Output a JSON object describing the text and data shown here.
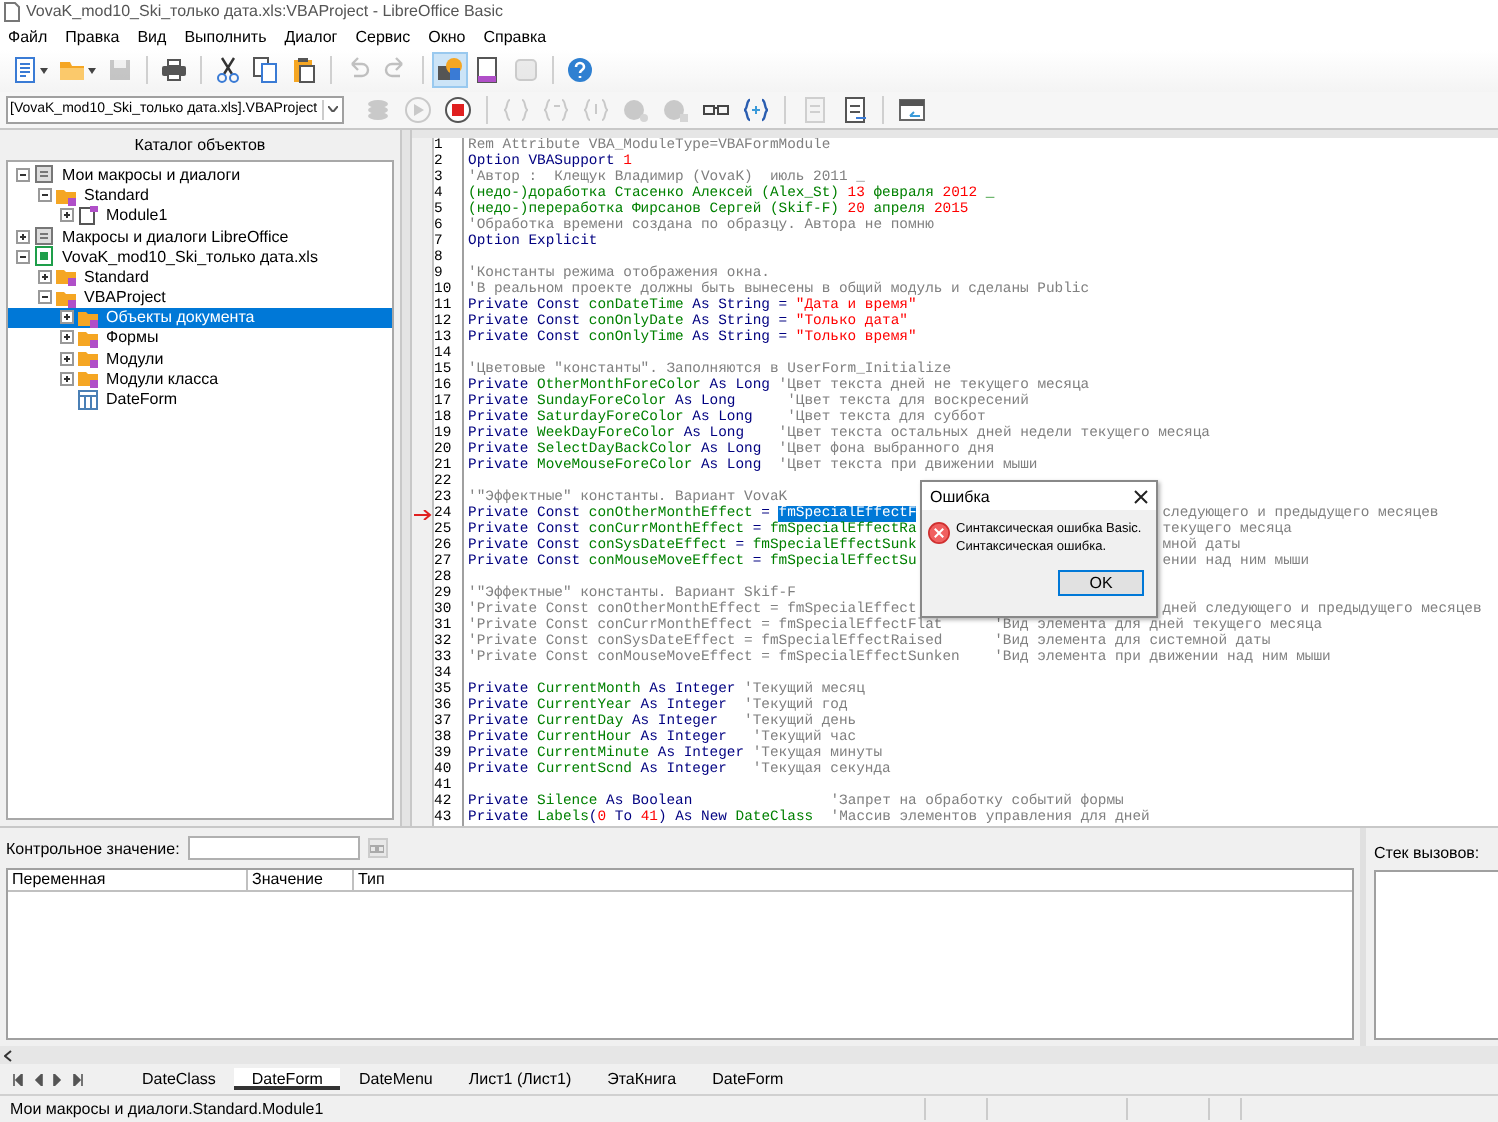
{
  "window": {
    "title": "VovaK_mod10_Ski_только дата.xls:VBAProject - LibreOffice Basic"
  },
  "menu": [
    "Файл",
    "Правка",
    "Вид",
    "Выполнить",
    "Диалог",
    "Сервис",
    "Окно",
    "Справка"
  ],
  "toolbar": [
    {
      "kind": "new",
      "menu": true,
      "disabled": false,
      "active": false
    },
    {
      "kind": "open",
      "menu": true,
      "disabled": false,
      "active": false
    },
    {
      "kind": "save",
      "menu": false,
      "disabled": true,
      "active": false
    },
    {
      "kind": "sep"
    },
    {
      "kind": "print",
      "menu": false,
      "disabled": false,
      "active": false
    },
    {
      "kind": "sep"
    },
    {
      "kind": "cut",
      "menu": false,
      "disabled": false,
      "active": false
    },
    {
      "kind": "copy",
      "menu": false,
      "disabled": false,
      "active": false
    },
    {
      "kind": "paste",
      "menu": false,
      "disabled": false,
      "active": false
    },
    {
      "kind": "sep"
    },
    {
      "kind": "undo",
      "menu": false,
      "disabled": true,
      "active": false
    },
    {
      "kind": "redo",
      "menu": false,
      "disabled": true,
      "active": false
    },
    {
      "kind": "sep"
    },
    {
      "kind": "catalog",
      "menu": false,
      "disabled": false,
      "active": true
    },
    {
      "kind": "dialog",
      "menu": false,
      "disabled": false,
      "active": false
    },
    {
      "kind": "macros",
      "menu": false,
      "disabled": true,
      "active": false
    },
    {
      "kind": "sep"
    },
    {
      "kind": "help",
      "menu": false,
      "disabled": false,
      "active": false
    }
  ],
  "library_select": {
    "value": "[VovaK_mod10_Ski_только дата.xls].VBAProject"
  },
  "debug_toolbar": [
    {
      "kind": "compile",
      "disabled": true
    },
    {
      "kind": "run",
      "disabled": true
    },
    {
      "kind": "stop",
      "disabled": false
    },
    {
      "kind": "sep"
    },
    {
      "kind": "step-into",
      "disabled": true
    },
    {
      "kind": "step-over",
      "disabled": true
    },
    {
      "kind": "step-out",
      "disabled": true
    },
    {
      "kind": "breakpoint",
      "disabled": true
    },
    {
      "kind": "breakpoints",
      "disabled": true
    },
    {
      "kind": "watch",
      "disabled": false
    },
    {
      "kind": "braces",
      "disabled": false
    },
    {
      "kind": "sep"
    },
    {
      "kind": "import",
      "disabled": true
    },
    {
      "kind": "export",
      "disabled": false
    },
    {
      "kind": "sep"
    },
    {
      "kind": "window",
      "disabled": false
    }
  ],
  "object_catalog": {
    "title": "Каталог объектов",
    "items": [
      {
        "label": "Мои макросы и диалоги",
        "kind": "library",
        "expanded": true,
        "selected": false,
        "children": [
          {
            "label": "Standard",
            "kind": "folder",
            "expanded": true,
            "selected": false,
            "children": [
              {
                "label": "Module1",
                "kind": "module",
                "expanded": false,
                "selected": false
              }
            ]
          }
        ]
      },
      {
        "label": "Макросы и диалоги LibreOffice",
        "kind": "library",
        "expanded": false,
        "selected": false
      },
      {
        "label": "VovaK_mod10_Ski_только дата.xls",
        "kind": "document",
        "expanded": true,
        "selected": false,
        "children": [
          {
            "label": "Standard",
            "kind": "folder",
            "expanded": false,
            "selected": false
          },
          {
            "label": "VBAProject",
            "kind": "folder",
            "expanded": true,
            "selected": false,
            "children": [
              {
                "label": "Объекты документа",
                "kind": "folder",
                "expanded": false,
                "selected": true
              },
              {
                "label": "Формы",
                "kind": "folder",
                "expanded": false,
                "selected": false
              },
              {
                "label": "Модули",
                "kind": "folder",
                "expanded": false,
                "selected": false
              },
              {
                "label": "Модули класса",
                "kind": "folder",
                "expanded": false,
                "selected": false
              },
              {
                "label": "DateForm",
                "kind": "dialog",
                "selected": false
              }
            ]
          }
        ]
      }
    ]
  },
  "editor": {
    "lines": [
      {
        "number": "1",
        "current": false,
        "segments": [
          {
            "kind": "comment",
            "text": "Rem Attribute VBA_ModuleType=VBAFormModule"
          }
        ]
      },
      {
        "number": "2",
        "current": false,
        "segments": [
          {
            "kind": "keyword",
            "text": "Option VBASupport "
          },
          {
            "kind": "number",
            "text": "1"
          }
        ]
      },
      {
        "number": "3",
        "current": false,
        "segments": [
          {
            "kind": "comment",
            "text": "'Автор :  Клещук Владимир (VovaK)  июль 2011 _"
          }
        ]
      },
      {
        "number": "4",
        "current": false,
        "segments": [
          {
            "kind": "name",
            "text": "(недо-)доработка Стасенко Алексей (Alex_St) "
          },
          {
            "kind": "number",
            "text": "13"
          },
          {
            "kind": "name",
            "text": " февраля "
          },
          {
            "kind": "number",
            "text": "2012"
          },
          {
            "kind": "name",
            "text": " _"
          }
        ]
      },
      {
        "number": "5",
        "current": false,
        "segments": [
          {
            "kind": "name",
            "text": "(недо-)переработка Фирсанов Сергей (Skif-F) "
          },
          {
            "kind": "number",
            "text": "20"
          },
          {
            "kind": "name",
            "text": " апреля "
          },
          {
            "kind": "number",
            "text": "2015"
          }
        ]
      },
      {
        "number": "6",
        "current": false,
        "segments": [
          {
            "kind": "comment",
            "text": "'Обработка времени создана по образцу. Автора не помню"
          }
        ]
      },
      {
        "number": "7",
        "current": false,
        "segments": [
          {
            "kind": "keyword",
            "text": "Option Explicit"
          }
        ]
      },
      {
        "number": "8",
        "current": false
      },
      {
        "number": "9",
        "current": false,
        "segments": [
          {
            "kind": "comment",
            "text": "'Константы режима отображения окна."
          }
        ]
      },
      {
        "number": "10",
        "current": false,
        "segments": [
          {
            "kind": "comment",
            "text": "'В реальном проекте должны быть вынесены в общий модуль и сделаны Public"
          }
        ]
      },
      {
        "number": "11",
        "current": false,
        "segments": [
          {
            "kind": "keyword",
            "text": "Private Const "
          },
          {
            "kind": "name",
            "text": "conDateTime"
          },
          {
            "kind": "keyword",
            "text": " As String = "
          },
          {
            "kind": "string",
            "text": "\"Дата и время\""
          }
        ]
      },
      {
        "number": "12",
        "current": false,
        "segments": [
          {
            "kind": "keyword",
            "text": "Private Const "
          },
          {
            "kind": "name",
            "text": "conOnlyDate"
          },
          {
            "kind": "keyword",
            "text": " As String = "
          },
          {
            "kind": "string",
            "text": "\"Только дата\""
          }
        ]
      },
      {
        "number": "13",
        "current": false,
        "segments": [
          {
            "kind": "keyword",
            "text": "Private Const "
          },
          {
            "kind": "name",
            "text": "conOnlyTime"
          },
          {
            "kind": "keyword",
            "text": " As String = "
          },
          {
            "kind": "string",
            "text": "\"Только время\""
          }
        ]
      },
      {
        "number": "14",
        "current": false
      },
      {
        "number": "15",
        "current": false,
        "segments": [
          {
            "kind": "comment",
            "text": "'Цветовые \"константы\". Заполняются в UserForm_Initialize"
          }
        ]
      },
      {
        "number": "16",
        "current": false,
        "segments": [
          {
            "kind": "keyword",
            "text": "Private "
          },
          {
            "kind": "name",
            "text": "OtherMonthForeColor"
          },
          {
            "kind": "keyword",
            "text": " As Long "
          },
          {
            "kind": "comment",
            "text": "'Цвет текста дней не текущего месяца"
          }
        ]
      },
      {
        "number": "17",
        "current": false,
        "segments": [
          {
            "kind": "keyword",
            "text": "Private "
          },
          {
            "kind": "name",
            "text": "SundayForeColor"
          },
          {
            "kind": "keyword",
            "text": " As Long      "
          },
          {
            "kind": "comment",
            "text": "'Цвет текста для воскресений"
          }
        ]
      },
      {
        "number": "18",
        "current": false,
        "segments": [
          {
            "kind": "keyword",
            "text": "Private "
          },
          {
            "kind": "name",
            "text": "SaturdayForeColor"
          },
          {
            "kind": "keyword",
            "text": " As Long    "
          },
          {
            "kind": "comment",
            "text": "'Цвет текста для суббот"
          }
        ]
      },
      {
        "number": "19",
        "current": false,
        "segments": [
          {
            "kind": "keyword",
            "text": "Private "
          },
          {
            "kind": "name",
            "text": "WeekDayForeColor"
          },
          {
            "kind": "keyword",
            "text": " As Long    "
          },
          {
            "kind": "comment",
            "text": "'Цвет текста остальных дней недели текущего месяца"
          }
        ]
      },
      {
        "number": "20",
        "current": false,
        "segments": [
          {
            "kind": "keyword",
            "text": "Private "
          },
          {
            "kind": "name",
            "text": "SelectDayBackColor"
          },
          {
            "kind": "keyword",
            "text": " As Long  "
          },
          {
            "kind": "comment",
            "text": "'Цвет фона выбранного дня"
          }
        ]
      },
      {
        "number": "21",
        "current": false,
        "segments": [
          {
            "kind": "keyword",
            "text": "Private "
          },
          {
            "kind": "name",
            "text": "MoveMouseForeColor"
          },
          {
            "kind": "keyword",
            "text": " As Long  "
          },
          {
            "kind": "comment",
            "text": "'Цвет текста при движении мыши"
          }
        ]
      },
      {
        "number": "22",
        "current": false
      },
      {
        "number": "23",
        "current": false,
        "segments": [
          {
            "kind": "comment",
            "text": "'\"Эффектные\" константы. Вариант VovaK"
          }
        ]
      },
      {
        "number": "24",
        "current": true,
        "segments": [
          {
            "kind": "keyword",
            "text": "Private Const "
          },
          {
            "kind": "name",
            "text": "conOtherMonthEffect"
          },
          {
            "kind": "keyword",
            "text": " = "
          },
          {
            "kind": "selected",
            "text": "fmSpecialEffectF"
          }
        ],
        "tail": "следующего и предыдущего месяцев"
      },
      {
        "number": "25",
        "current": false,
        "segments": [
          {
            "kind": "keyword",
            "text": "Private Const "
          },
          {
            "kind": "name",
            "text": "conCurrMonthEffect"
          },
          {
            "kind": "keyword",
            "text": " = "
          },
          {
            "kind": "name",
            "text": "fmSpecialEffectRa"
          }
        ],
        "tail": "текущего месяца"
      },
      {
        "number": "26",
        "current": false,
        "segments": [
          {
            "kind": "keyword",
            "text": "Private Const "
          },
          {
            "kind": "name",
            "text": "conSysDateEffect"
          },
          {
            "kind": "keyword",
            "text": " = "
          },
          {
            "kind": "name",
            "text": "fmSpecialEffectSunk"
          }
        ],
        "tail": "мной даты"
      },
      {
        "number": "27",
        "current": false,
        "segments": [
          {
            "kind": "keyword",
            "text": "Private Const "
          },
          {
            "kind": "name",
            "text": "conMouseMoveEffect"
          },
          {
            "kind": "keyword",
            "text": " = "
          },
          {
            "kind": "name",
            "text": "fmSpecialEffectSu"
          }
        ],
        "tail": "ении над ним мыши"
      },
      {
        "number": "28",
        "current": false
      },
      {
        "number": "29",
        "current": false,
        "segments": [
          {
            "kind": "comment",
            "text": "'\"Эффектные\" константы. Вариант Skif-F"
          }
        ]
      },
      {
        "number": "30",
        "current": false,
        "segments": [
          {
            "kind": "comment",
            "text": "'Private Const conOtherMonthEffect = fmSpecialEffect"
          }
        ],
        "tail": "дней следующего и предыдущего месяцев"
      },
      {
        "number": "31",
        "current": false,
        "segments": [
          {
            "kind": "comment",
            "text": "'Private Const conCurrMonthEffect = fmSpecialEffectFlat      'Вид элемента для дней текущего месяца"
          }
        ]
      },
      {
        "number": "32",
        "current": false,
        "segments": [
          {
            "kind": "comment",
            "text": "'Private Const conSysDateEffect = fmSpecialEffectRaised      'Вид элемента для системной даты"
          }
        ]
      },
      {
        "number": "33",
        "current": false,
        "segments": [
          {
            "kind": "comment",
            "text": "'Private Const conMouseMoveEffect = fmSpecialEffectSunken    'Вид элемента при движении над ним мыши"
          }
        ]
      },
      {
        "number": "34",
        "current": false
      },
      {
        "number": "35",
        "current": false,
        "segments": [
          {
            "kind": "keyword",
            "text": "Private "
          },
          {
            "kind": "name",
            "text": "CurrentMonth"
          },
          {
            "kind": "keyword",
            "text": " As Integer "
          },
          {
            "kind": "comment",
            "text": "'Текущий месяц"
          }
        ]
      },
      {
        "number": "36",
        "current": false,
        "segments": [
          {
            "kind": "keyword",
            "text": "Private "
          },
          {
            "kind": "name",
            "text": "CurrentYear"
          },
          {
            "kind": "keyword",
            "text": " As Integer  "
          },
          {
            "kind": "comment",
            "text": "'Текущий год"
          }
        ]
      },
      {
        "number": "37",
        "current": false,
        "segments": [
          {
            "kind": "keyword",
            "text": "Private "
          },
          {
            "kind": "name",
            "text": "CurrentDay"
          },
          {
            "kind": "keyword",
            "text": " As Integer   "
          },
          {
            "kind": "comment",
            "text": "'Текущий день"
          }
        ]
      },
      {
        "number": "38",
        "current": false,
        "segments": [
          {
            "kind": "keyword",
            "text": "Private "
          },
          {
            "kind": "name",
            "text": "CurrentHour"
          },
          {
            "kind": "keyword",
            "text": " As Integer   "
          },
          {
            "kind": "comment",
            "text": "'Текущий час"
          }
        ]
      },
      {
        "number": "39",
        "current": false,
        "segments": [
          {
            "kind": "keyword",
            "text": "Private "
          },
          {
            "kind": "name",
            "text": "CurrentMinute"
          },
          {
            "kind": "keyword",
            "text": " As Integer "
          },
          {
            "kind": "comment",
            "text": "'Текущая минуты"
          }
        ]
      },
      {
        "number": "40",
        "current": false,
        "segments": [
          {
            "kind": "keyword",
            "text": "Private "
          },
          {
            "kind": "name",
            "text": "CurrentScnd"
          },
          {
            "kind": "keyword",
            "text": " As Integer   "
          },
          {
            "kind": "comment",
            "text": "'Текущая секунда"
          }
        ]
      },
      {
        "number": "41",
        "current": false
      },
      {
        "number": "42",
        "current": false,
        "segments": [
          {
            "kind": "keyword",
            "text": "Private "
          },
          {
            "kind": "name",
            "text": "Silence"
          },
          {
            "kind": "keyword",
            "text": " As Boolean                "
          },
          {
            "kind": "comment",
            "text": "'Запрет на обработку событий формы"
          }
        ]
      },
      {
        "number": "43",
        "current": false,
        "segments": [
          {
            "kind": "keyword",
            "text": "Private "
          },
          {
            "kind": "name",
            "text": "Labels"
          },
          {
            "kind": "keyword",
            "text": "("
          },
          {
            "kind": "number",
            "text": "0"
          },
          {
            "kind": "keyword",
            "text": " To "
          },
          {
            "kind": "number",
            "text": "41"
          },
          {
            "kind": "keyword",
            "text": ") As New "
          },
          {
            "kind": "name",
            "text": "DateClass"
          },
          {
            "kind": "comment",
            "text": "  'Массив элементов управления для дней"
          }
        ]
      }
    ]
  },
  "error_dialog": {
    "title": "Ошибка",
    "message": [
      "Синтаксическая ошибка Basic.",
      "Синтаксическая ошибка."
    ],
    "button": "OK"
  },
  "watch": {
    "label": "Контрольное значение:",
    "columns": [
      "Переменная",
      "Значение",
      "Тип"
    ]
  },
  "call_stack": {
    "label": "Стек вызовов:"
  },
  "tabs": [
    {
      "label": "DateClass",
      "selected": false
    },
    {
      "label": "DateForm",
      "selected": true
    },
    {
      "label": "DateMenu",
      "selected": false
    },
    {
      "label": "Лист1 (Лист1)",
      "selected": false
    },
    {
      "label": "ЭтаКнига",
      "selected": false
    },
    {
      "label": "DateForm",
      "selected": false
    }
  ],
  "status_bar": {
    "text": "Мои макросы и диалоги.Standard.Module1"
  }
}
